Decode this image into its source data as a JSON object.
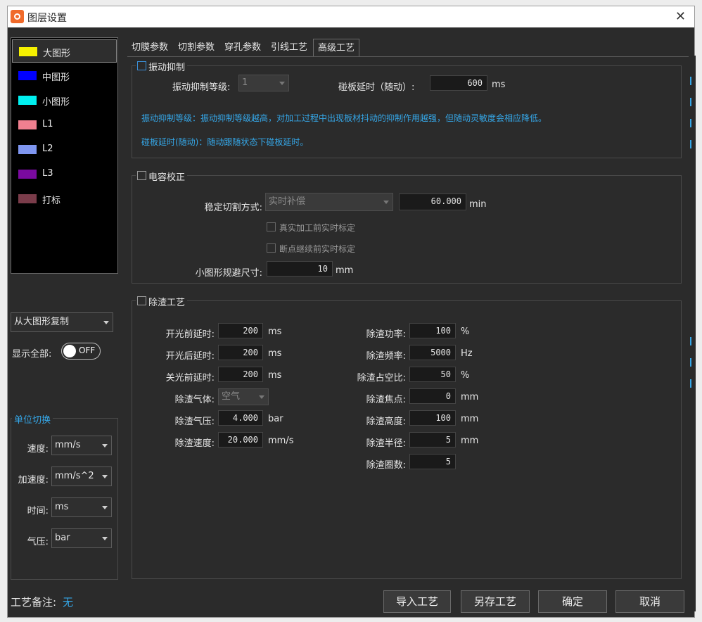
{
  "window": {
    "title": "图层设置"
  },
  "layers": [
    {
      "label": "大图形",
      "color": "#f5f000",
      "selected": true
    },
    {
      "label": "中图形",
      "color": "#0000ff"
    },
    {
      "label": "小图形",
      "color": "#00f0f0"
    },
    {
      "label": "L1",
      "color": "#f08090"
    },
    {
      "label": "L2",
      "color": "#7f96f0"
    },
    {
      "label": "L3",
      "color": "#7a0aa0"
    },
    {
      "label": "打标",
      "color": "#7a3c4a"
    }
  ],
  "copy_from": "从大图形复制",
  "show_all": {
    "label": "显示全部:",
    "state": "OFF"
  },
  "units": {
    "title": "单位切换",
    "speed": {
      "label": "速度:",
      "value": "mm/s"
    },
    "accel": {
      "label": "加速度:",
      "value": "mm/s^2"
    },
    "time": {
      "label": "时间:",
      "value": "ms"
    },
    "pressure": {
      "label": "气压:",
      "value": "bar"
    }
  },
  "remark": {
    "label": "工艺备注:",
    "value": "无"
  },
  "tabs": [
    "切膜参数",
    "切割参数",
    "穿孔参数",
    "引线工艺",
    "高级工艺"
  ],
  "vibration": {
    "title": "振动抑制",
    "level_label": "振动抑制等级:",
    "level_value": "1",
    "delay_label": "碰板延时（随动）:",
    "delay_value": "600",
    "delay_unit": "ms",
    "note1": "振动抑制等级：振动抑制等级越高，对加工过程中出现板材抖动的抑制作用越强，但随动灵敏度会相应降低。",
    "note2": "碰板延时(随动)：随动跟随状态下碰板延时。"
  },
  "capacitance": {
    "title": "电容校正",
    "mode_label": "稳定切割方式:",
    "mode_value": "实时补偿",
    "mode_time": "60.000",
    "mode_unit": "min",
    "opt1": "真实加工前实时标定",
    "opt2": "断点继续前实时标定",
    "avoid_label": "小图形规避尺寸:",
    "avoid_value": "10",
    "avoid_unit": "mm"
  },
  "slag": {
    "title": "除渣工艺",
    "left": [
      {
        "label": "开光前延时:",
        "value": "200",
        "unit": "ms"
      },
      {
        "label": "开光后延时:",
        "value": "200",
        "unit": "ms"
      },
      {
        "label": "关光前延时:",
        "value": "200",
        "unit": "ms"
      },
      {
        "label": "除渣气体:",
        "value": "空气",
        "unit": ""
      },
      {
        "label": "除渣气压:",
        "value": "4.000",
        "unit": "bar"
      },
      {
        "label": "除渣速度:",
        "value": "20.000",
        "unit": "mm/s"
      }
    ],
    "right": [
      {
        "label": "除渣功率:",
        "value": "100",
        "unit": "%"
      },
      {
        "label": "除渣频率:",
        "value": "5000",
        "unit": "Hz"
      },
      {
        "label": "除渣占空比:",
        "value": "50",
        "unit": "%"
      },
      {
        "label": "除渣焦点:",
        "value": "0",
        "unit": "mm"
      },
      {
        "label": "除渣高度:",
        "value": "100",
        "unit": "mm"
      },
      {
        "label": "除渣半径:",
        "value": "5",
        "unit": "mm"
      },
      {
        "label": "除渣圈数:",
        "value": "5",
        "unit": ""
      }
    ]
  },
  "buttons": {
    "import": "导入工艺",
    "save_as": "另存工艺",
    "ok": "确定",
    "cancel": "取消"
  }
}
